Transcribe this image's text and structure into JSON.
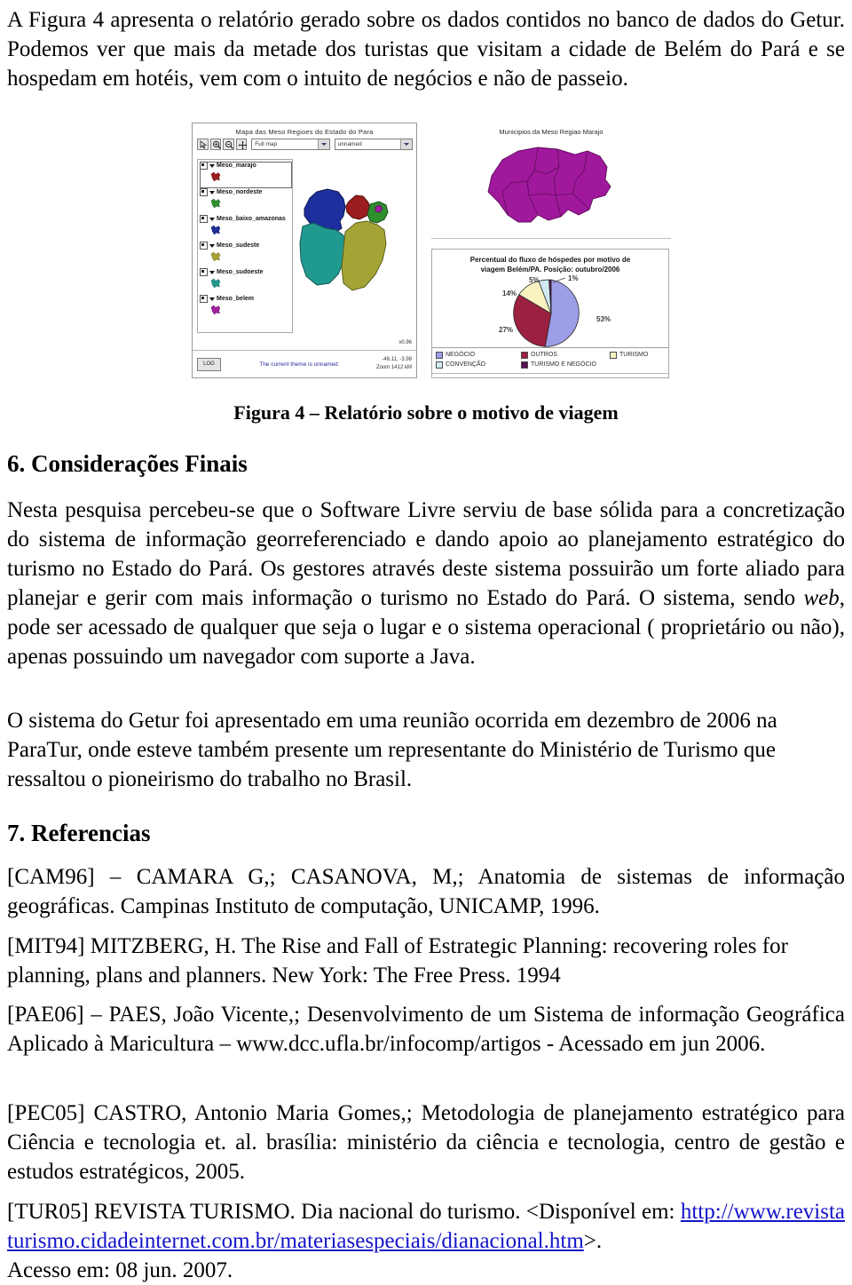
{
  "document": {
    "intro_paragraph": "A Figura 4 apresenta o relatório gerado sobre os dados contidos no banco de dados do Getur. Podemos ver que mais da metade dos turistas que visitam a cidade de Belém do Pará e se hospedam em hotéis, vem com o intuito de negócios e não de passeio.",
    "figure_caption": "Figura 4 – Relatório sobre o motivo de viagem",
    "section6_heading": "6. Considerações Finais",
    "section6_p1_a": "Nesta pesquisa percebeu-se que o Software Livre serviu de base sólida para a concretização do sistema de informação georreferenciado e dando apoio ao planejamento estratégico do turismo no Estado do Pará. Os gestores através deste sistema possuirão um forte aliado para planejar e gerir com mais informação o turismo no Estado do Pará. O sistema, sendo ",
    "section6_p1_italic": "web",
    "section6_p1_b": ", pode ser acessado de qualquer que seja o lugar e o sistema operacional ( proprietário ou não), apenas possuindo um navegador com suporte a Java.",
    "section6_p2": "O sistema do Getur foi apresentado em uma reunião ocorrida em dezembro de 2006 na ParaTur, onde esteve também presente um representante do Ministério de Turismo que ressaltou o pioneirismo do trabalho no Brasil.",
    "section7_heading": "7. Referencias",
    "references": [
      "[CAM96] – CAMARA G,; CASANOVA, M,; Anatomia de sistemas de informação geográficas. Campinas Instituto de computação, UNICAMP, 1996.",
      "[MIT94] MITZBERG, H. The Rise and Fall of Estrategic Planning: recovering roles for planning, plans and planners. New York: The Free Press. 1994",
      "[PAE06] – PAES, João Vicente,;  Desenvolvimento de um Sistema de informação Geográfica Aplicado à Maricultura – www.dcc.ufla.br/infocomp/artigos -  Acessado em jun 2006.",
      "[PEC05] CASTRO, Antonio Maria Gomes,; Metodologia de planejamento estratégico para Ciência e tecnologia et. al. brasília: ministério da ciência e tecnologia, centro de gestão e estudos estratégicos, 2005."
    ],
    "ref_tur05_prefix": "[TUR05] REVISTA TURISMO. Dia nacional do turismo. <Disponível em:",
    "ref_tur05_url": "http://www.revistaturismo.cidadeinternet.com.br/materiasespeciais/dianacional.htm",
    "ref_tur05_suffix": ">.",
    "ref_tur05_access": "Acesso em: 08 jun. 2007."
  },
  "figure": {
    "gis_panel": {
      "title": "Mapa das Meso Regioes do Estado do Para",
      "toolbar": {
        "select_icon": "arrow-select-icon",
        "zoom_in_icon": "zoom-in-icon",
        "zoom_out_icon": "zoom-out-icon",
        "pan_icon": "pan-icon",
        "extent_select_value": "Full map",
        "theme_select_value": "unnamed"
      },
      "layers": [
        {
          "label": "Meso_marajo",
          "color": "#9c1d1d",
          "selected": true
        },
        {
          "label": "Meso_nordeste",
          "color": "#2f8f2f",
          "selected": false
        },
        {
          "label": "Meso_baixo_amazonas",
          "color": "#1d2f9c",
          "selected": false
        },
        {
          "label": "Meso_sudeste",
          "color": "#a4a436",
          "selected": false
        },
        {
          "label": "Meso_sudoeste",
          "color": "#20998f",
          "selected": false
        },
        {
          "label": "Meso_belem",
          "color": "#a020a0",
          "selected": false
        }
      ],
      "version": "v0.96",
      "log_button": "LOG",
      "status_message": "The current theme is unnamed",
      "coordinates": "-46.11, -3.98",
      "zoom_text": "Zoom  1412 kM"
    },
    "municipios_panel": {
      "title": "Municipios da Meso Regiao Marajo",
      "fill_color": "#a0189c"
    },
    "chart_panel": {
      "title_line1": "Percentual do fluxo de hóspedes por motivo de",
      "title_line2": "viagem Belém/PA. Posição: outubro/2006"
    }
  },
  "chart_data": {
    "type": "pie",
    "title": "Percentual do fluxo de hóspedes por motivo de viagem Belém/PA. Posição: outubro/2006",
    "categories": [
      "NEGÓCIO",
      "OUTROS",
      "TURISMO",
      "CONVENÇÃO",
      "TURISMO E NEGÓCIO"
    ],
    "values": [
      53,
      27,
      14,
      5,
      1
    ],
    "value_labels": [
      "53%",
      "27%",
      "14%",
      "5%",
      "1%"
    ],
    "colors": [
      "#9d9de8",
      "#9c2040",
      "#f7f2c0",
      "#cfe9f2",
      "#5a1050"
    ],
    "legend_position": "bottom",
    "legend_entries": [
      {
        "label": "NEGÓCIO",
        "color": "#9d9de8"
      },
      {
        "label": "OUTROS",
        "color": "#9c2040"
      },
      {
        "label": "TURISMO",
        "color": "#f7f2c0"
      },
      {
        "label": "CONVENÇÃO",
        "color": "#cfe9f2"
      },
      {
        "label": "TURISMO E NEGÓCIO",
        "color": "#5a1050"
      }
    ],
    "unit": "%"
  }
}
